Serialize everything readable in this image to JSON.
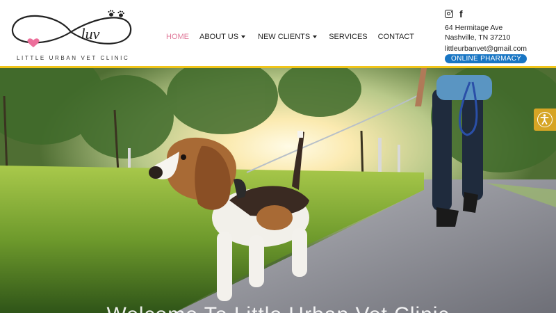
{
  "brand": {
    "logo_mark_text": "luv",
    "name": "LITTLE URBAN VET CLINIC",
    "colors": {
      "accent_pink": "#e07a9a",
      "yellow": "#f0c419",
      "pharmacy_blue": "#1976c4",
      "accessibility": "#d6a525"
    }
  },
  "nav": {
    "items": [
      {
        "label": "HOME",
        "active": true
      },
      {
        "label": "ABOUT US",
        "has_dropdown": true
      },
      {
        "label": "NEW CLIENTS",
        "has_dropdown": true
      },
      {
        "label": "SERVICES"
      },
      {
        "label": "CONTACT"
      }
    ]
  },
  "contact": {
    "social_icons": [
      "instagram-icon",
      "facebook-icon"
    ],
    "facebook_glyph": "f",
    "address_line1": "64 Hermitage Ave",
    "address_line2": "Nashville, TN 37210",
    "email": "littleurbanvet@gmail.com",
    "pharmacy_button": "ONLINE PHARMACY"
  },
  "hero": {
    "image": "beagle-on-leash-walk-photo",
    "heading": "Welcome To Little Urban Vet Clinic"
  },
  "accessibility": {
    "icon": "accessibility-icon"
  }
}
